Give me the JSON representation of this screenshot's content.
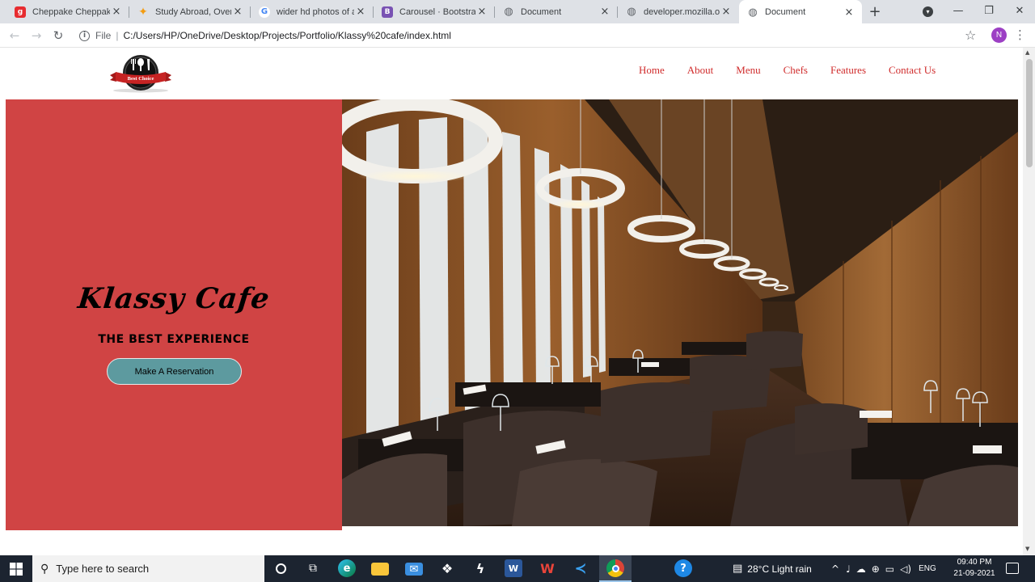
{
  "browser": {
    "tabs": [
      {
        "title": "Cheppake Cheppake (",
        "icon": "gaana-icon",
        "icon_glyph": "g",
        "icon_color": "#e72c30",
        "active": false
      },
      {
        "title": "Study Abroad, Overse",
        "icon": "pinwheel-icon",
        "icon_glyph": "✦",
        "icon_color": "#f39c12",
        "active": false
      },
      {
        "title": "wider hd photos of ab",
        "icon": "google-icon",
        "icon_glyph": "G",
        "icon_color": "#4285f4",
        "active": false
      },
      {
        "title": "Carousel · Bootstrap v",
        "icon": "bootstrap-icon",
        "icon_glyph": "B",
        "icon_color": "#7952b3",
        "active": false
      },
      {
        "title": "Document",
        "icon": "globe-icon",
        "icon_glyph": "◍",
        "icon_color": "#5f6368",
        "active": false
      },
      {
        "title": "developer.mozilla.org",
        "icon": "globe-icon",
        "icon_glyph": "◍",
        "icon_color": "#5f6368",
        "active": false
      },
      {
        "title": "Document",
        "icon": "globe-icon",
        "icon_glyph": "◍",
        "icon_color": "#5f6368",
        "active": true
      }
    ],
    "new_tab_label": "+",
    "address": {
      "scheme_label": "File",
      "url": "C:/Users/HP/OneDrive/Desktop/Projects/Portfolio/Klassy%20cafe/index.html"
    },
    "profile_initial": "N"
  },
  "site": {
    "logo_text": "Best Choice",
    "nav": [
      {
        "label": "Home"
      },
      {
        "label": "About"
      },
      {
        "label": "Menu"
      },
      {
        "label": "Chefs"
      },
      {
        "label": "Features"
      },
      {
        "label": "Contact Us"
      }
    ],
    "hero": {
      "title": "Klassy Cafe",
      "subtitle": "THE BEST EXPERIENCE",
      "button_label": "Make A Reservation"
    },
    "colors": {
      "accent": "#d04444",
      "nav_link": "#d02c2c",
      "button": "#5d9a9f"
    }
  },
  "taskbar": {
    "search_placeholder": "Type here to search",
    "weather": "28°C  Light rain",
    "language": "ENG",
    "time": "09:40 PM",
    "date": "21-09-2021"
  }
}
